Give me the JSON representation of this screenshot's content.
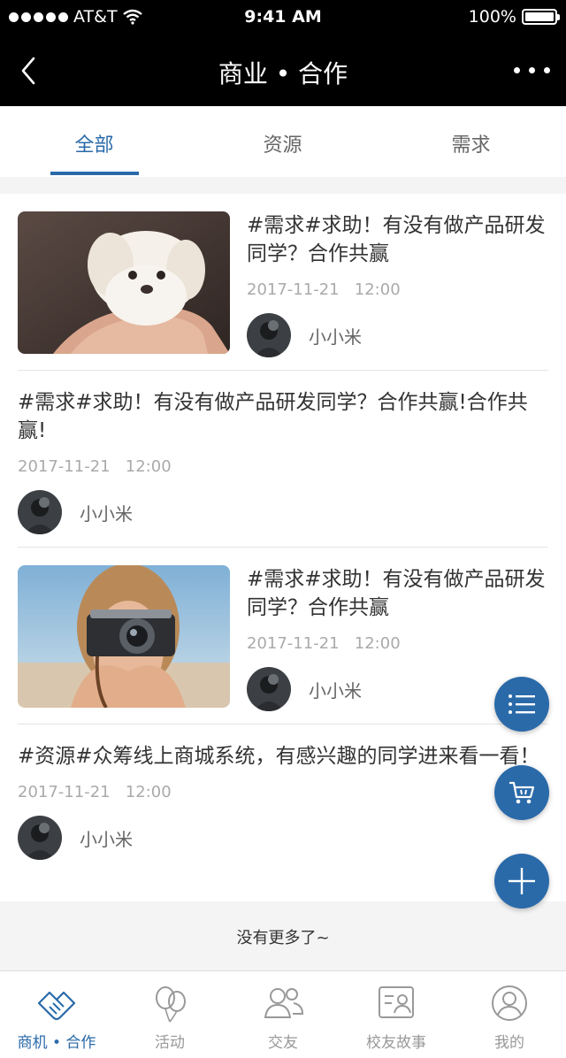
{
  "status_bar": {
    "carrier": "AT&T",
    "time": "9:41 AM",
    "battery": "100%"
  },
  "nav": {
    "title": "商业 • 合作"
  },
  "tabs": [
    {
      "label": "全部",
      "active": true
    },
    {
      "label": "资源",
      "active": false
    },
    {
      "label": "需求",
      "active": false
    }
  ],
  "posts": [
    {
      "title": "#需求#求助！有没有做产品研发同学？合作共赢",
      "date": "2017-11-21",
      "time": "12:00",
      "author": "小小米",
      "thumb": "puppy-photo"
    },
    {
      "title": "#需求#求助！有没有做产品研发同学？合作共赢!合作共赢!",
      "date": "2017-11-21",
      "time": "12:00",
      "author": "小小米"
    },
    {
      "title": "#需求#求助！有没有做产品研发同学？合作共赢",
      "date": "2017-11-21",
      "time": "12:00",
      "author": "小小米",
      "thumb": "camera-girl-photo"
    },
    {
      "title": "#资源#众筹线上商城系统，有感兴趣的同学进来看一看！",
      "date": "2017-11-21",
      "time": "12:00",
      "author": "小小米"
    }
  ],
  "no_more": "没有更多了~",
  "tabbar": [
    {
      "label": "商机 • 合作",
      "icon": "handshake-icon",
      "active": true
    },
    {
      "label": "活动",
      "icon": "balloon-icon",
      "active": false
    },
    {
      "label": "交友",
      "icon": "people-icon",
      "active": false
    },
    {
      "label": "校友故事",
      "icon": "story-card-icon",
      "active": false
    },
    {
      "label": "我的",
      "icon": "profile-icon",
      "active": false
    }
  ],
  "colors": {
    "accent": "#2a6aa9",
    "navbar": "#000000"
  }
}
